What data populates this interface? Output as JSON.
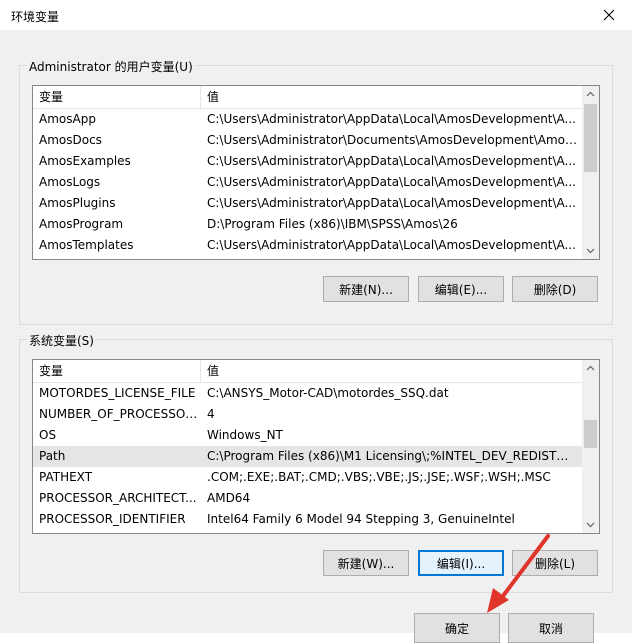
{
  "window": {
    "title": "环境变量"
  },
  "user_vars": {
    "group_label": "Administrator 的用户变量(U)",
    "headers": {
      "name": "变量",
      "value": "值"
    },
    "rows": [
      {
        "name": "AmosApp",
        "value": "C:\\Users\\Administrator\\AppData\\Local\\AmosDevelopment\\A..."
      },
      {
        "name": "AmosDocs",
        "value": "C:\\Users\\Administrator\\Documents\\AmosDevelopment\\Amos..."
      },
      {
        "name": "AmosExamples",
        "value": "C:\\Users\\Administrator\\AppData\\Local\\AmosDevelopment\\A..."
      },
      {
        "name": "AmosLogs",
        "value": "C:\\Users\\Administrator\\AppData\\Local\\AmosDevelopment\\A..."
      },
      {
        "name": "AmosPlugins",
        "value": "C:\\Users\\Administrator\\AppData\\Local\\AmosDevelopment\\A..."
      },
      {
        "name": "AmosProgram",
        "value": "D:\\Program Files (x86)\\IBM\\SPSS\\Amos\\26"
      },
      {
        "name": "AmosTemplates",
        "value": "C:\\Users\\Administrator\\AppData\\Local\\AmosDevelopment\\A..."
      }
    ],
    "buttons": {
      "new": "新建(N)...",
      "edit": "编辑(E)...",
      "delete": "删除(D)"
    }
  },
  "system_vars": {
    "group_label": "系统变量(S)",
    "headers": {
      "name": "变量",
      "value": "值"
    },
    "rows": [
      {
        "name": "MOTORDES_LICENSE_FILE",
        "value": "C:\\ANSYS_Motor-CAD\\motordes_SSQ.dat"
      },
      {
        "name": "NUMBER_OF_PROCESSORS",
        "value": "4"
      },
      {
        "name": "OS",
        "value": "Windows_NT"
      },
      {
        "name": "Path",
        "value": "C:\\Program Files (x86)\\M1 Licensing\\;%INTEL_DEV_REDIST%r..."
      },
      {
        "name": "PATHEXT",
        "value": ".COM;.EXE;.BAT;.CMD;.VBS;.VBE;.JS;.JSE;.WSF;.WSH;.MSC"
      },
      {
        "name": "PROCESSOR_ARCHITECT...",
        "value": "AMD64"
      },
      {
        "name": "PROCESSOR_IDENTIFIER",
        "value": "Intel64 Family 6 Model 94 Stepping 3, GenuineIntel"
      }
    ],
    "selected_index": 3,
    "buttons": {
      "new": "新建(W)...",
      "edit": "编辑(I)...",
      "delete": "删除(L)"
    }
  },
  "footer": {
    "ok": "确定",
    "cancel": "取消"
  },
  "colors": {
    "accent": "#0078d7",
    "annotation_arrow": "#e0352b"
  }
}
